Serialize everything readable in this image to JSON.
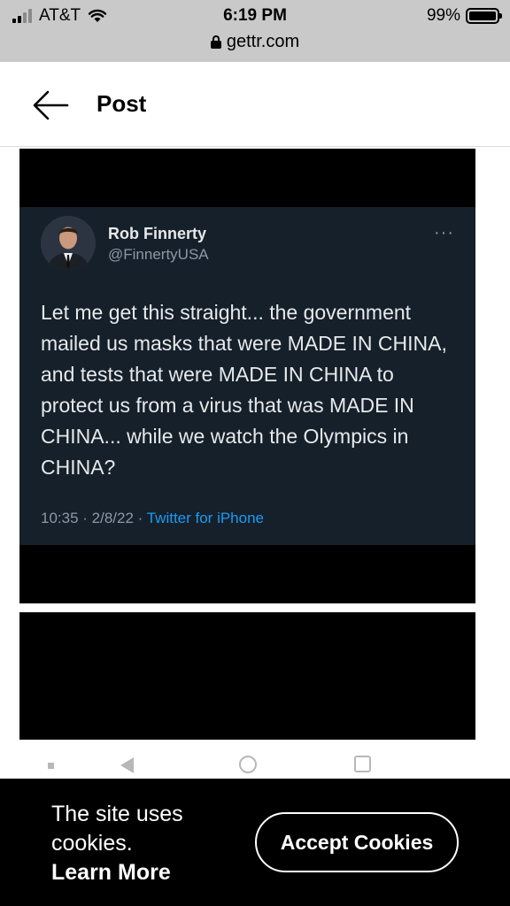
{
  "status_bar": {
    "carrier": "AT&T",
    "time": "6:19 PM",
    "battery_percent": "99%",
    "battery_level": 0.99,
    "signal_bars": 2,
    "url": "gettr.com"
  },
  "header": {
    "title": "Post"
  },
  "tweet": {
    "author_name": "Rob Finnerty",
    "author_handle": "@FinnertyUSA",
    "more_label": "···",
    "text": "Let me get this straight... the government mailed us masks that were MADE IN CHINA, and tests that were MADE IN CHINA to protect us from a virus that was MADE IN CHINA... while we watch the Olympics in CHINA?",
    "timestamp": "10:35 · 2/8/22 · ",
    "source": "Twitter for iPhone"
  },
  "cookie_banner": {
    "message": "The site uses cookies.",
    "learn_more": "Learn More",
    "accept_label": "Accept Cookies"
  },
  "colors": {
    "status_bar_bg": "#c9c9c9",
    "tweet_bg": "#15202b",
    "tweet_link": "#1d9bf0",
    "banner_bg": "#000000"
  }
}
